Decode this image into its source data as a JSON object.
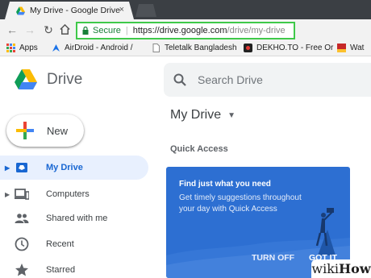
{
  "browser": {
    "tab_title": "My Drive - Google Drive",
    "tab_close": "×",
    "url_secure_label": "Secure",
    "url_host": "https://drive.google.com",
    "url_path": "/drive/my-drive",
    "omnibox_highlight_color": "#3fc94a"
  },
  "bookmarks": [
    {
      "label": "Apps",
      "icon": "apps-grid-icon"
    },
    {
      "label": "AirDroid - Android /",
      "icon": "airdroid-icon"
    },
    {
      "label": "Teletalk Bangladesh",
      "icon": "page-icon"
    },
    {
      "label": "DEKHO.TO - Free Or",
      "icon": "dekho-icon"
    },
    {
      "label": "Wat",
      "icon": "wat-icon"
    }
  ],
  "drive": {
    "app_name": "Drive",
    "search_placeholder": "Search Drive",
    "new_button_label": "New",
    "nav": [
      {
        "label": "My Drive",
        "icon": "my-drive-icon",
        "active": true,
        "expandable": true
      },
      {
        "label": "Computers",
        "icon": "computers-icon",
        "active": false,
        "expandable": true
      },
      {
        "label": "Shared with me",
        "icon": "shared-people-icon",
        "active": false,
        "expandable": false
      },
      {
        "label": "Recent",
        "icon": "clock-icon",
        "active": false,
        "expandable": false
      },
      {
        "label": "Starred",
        "icon": "star-icon",
        "active": false,
        "expandable": false
      }
    ],
    "page_title": "My Drive",
    "quick_access_heading": "Quick Access",
    "quick_access_card": {
      "title": "Find just what you need",
      "body": "Get timely suggestions throughout your day with Quick Access",
      "turn_off_label": "TURN OFF",
      "got_it_label": "GOT IT",
      "background_color": "#2d6fd2"
    }
  },
  "watermark": {
    "prefix": "wiki",
    "suffix": "How"
  },
  "colors": {
    "active_nav_bg": "#e8f0fe",
    "active_nav_text": "#1967d2",
    "secure_green": "#188038"
  }
}
